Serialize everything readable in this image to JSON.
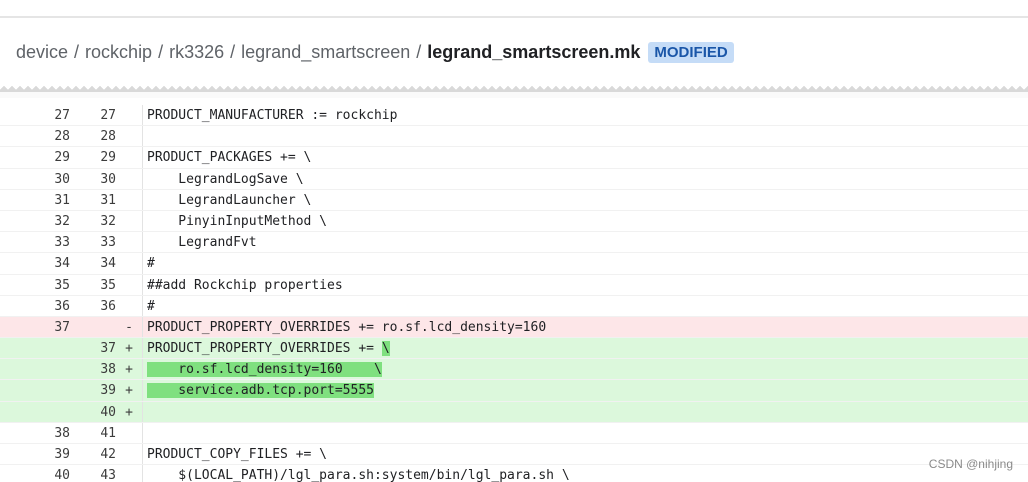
{
  "breadcrumb": {
    "parts": [
      "device",
      "rockchip",
      "rk3326",
      "legrand_smartscreen"
    ],
    "separator": "/",
    "file": "legrand_smartscreen.mk",
    "badge": "MODIFIED"
  },
  "diff_rows": [
    {
      "old": "27",
      "new": "27",
      "mark": "",
      "type": "ctx",
      "code": "PRODUCT_MANUFACTURER := rockchip"
    },
    {
      "old": "28",
      "new": "28",
      "mark": "",
      "type": "ctx",
      "code": ""
    },
    {
      "old": "29",
      "new": "29",
      "mark": "",
      "type": "ctx",
      "code": "PRODUCT_PACKAGES += \\"
    },
    {
      "old": "30",
      "new": "30",
      "mark": "",
      "type": "ctx",
      "code": "    LegrandLogSave \\"
    },
    {
      "old": "31",
      "new": "31",
      "mark": "",
      "type": "ctx",
      "code": "    LegrandLauncher \\"
    },
    {
      "old": "32",
      "new": "32",
      "mark": "",
      "type": "ctx",
      "code": "    PinyinInputMethod \\"
    },
    {
      "old": "33",
      "new": "33",
      "mark": "",
      "type": "ctx",
      "code": "    LegrandFvt"
    },
    {
      "old": "34",
      "new": "34",
      "mark": "",
      "type": "ctx",
      "code": "#"
    },
    {
      "old": "35",
      "new": "35",
      "mark": "",
      "type": "ctx",
      "code": "##add Rockchip properties"
    },
    {
      "old": "36",
      "new": "36",
      "mark": "",
      "type": "ctx",
      "code": "#"
    },
    {
      "old": "37",
      "new": "",
      "mark": "-",
      "type": "del",
      "code": "PRODUCT_PROPERTY_OVERRIDES += ro.sf.lcd_density=160"
    },
    {
      "old": "",
      "new": "37",
      "mark": "+",
      "type": "add",
      "code": "PRODUCT_PROPERTY_OVERRIDES += \\"
    },
    {
      "old": "",
      "new": "38",
      "mark": "+",
      "type": "add",
      "code": "    ro.sf.lcd_density=160    \\"
    },
    {
      "old": "",
      "new": "39",
      "mark": "+",
      "type": "add",
      "code": "    service.adb.tcp.port=5555"
    },
    {
      "old": "",
      "new": "40",
      "mark": "+",
      "type": "add",
      "code": ""
    },
    {
      "old": "38",
      "new": "41",
      "mark": "",
      "type": "ctx",
      "code": ""
    },
    {
      "old": "39",
      "new": "42",
      "mark": "",
      "type": "ctx",
      "code": "PRODUCT_COPY_FILES += \\"
    },
    {
      "old": "40",
      "new": "43",
      "mark": "",
      "type": "ctx",
      "code": "    $(LOCAL_PATH)/lgl_para.sh:system/bin/lgl_para.sh \\"
    }
  ],
  "watermark": "CSDN @nihjing"
}
